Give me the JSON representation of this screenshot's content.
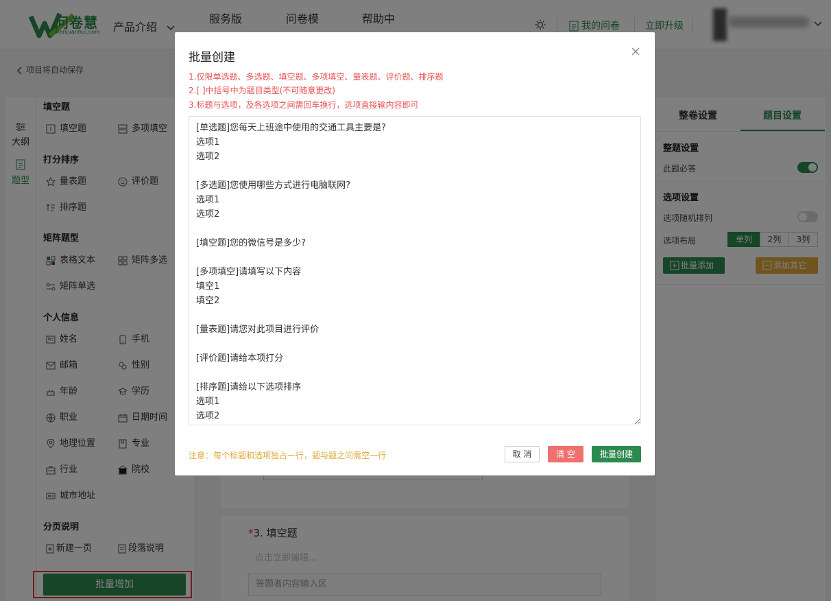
{
  "header": {
    "logo_text": "问卷慧",
    "logo_sub": "wenjuanhui.com",
    "nav": [
      "产品介绍",
      "服务版本",
      "问卷模板",
      "帮助中心"
    ],
    "my_survey": "我的问卷",
    "upgrade": "立即升级",
    "brand_color": "#2c8a4f"
  },
  "subbar": {
    "back_label": "项目将自动保存"
  },
  "iconbar": {
    "outline": "大纲",
    "types": "题型"
  },
  "left": {
    "groups": {
      "fill": "填空题",
      "score": "打分排序",
      "matrix": "矩阵题型",
      "personal": "个人信息",
      "paging": "分页说明"
    },
    "items": {
      "fill_blank": "填空题",
      "multi_fill": "多项填空",
      "scale": "量表题",
      "rating": "评价题",
      "sort": "排序题",
      "table_text": "表格文本",
      "matrix_multi": "矩阵多选",
      "matrix_single": "矩阵单选",
      "name": "姓名",
      "phone": "手机",
      "email": "邮箱",
      "gender": "性别",
      "age": "年龄",
      "education": "学历",
      "job": "职业",
      "datetime": "日期时间",
      "location": "地理位置",
      "major": "专业",
      "industry": "行业",
      "school": "院校",
      "address": "城市地址",
      "new_page": "新建一页",
      "paragraph": "段落说明"
    },
    "batch_add": "批量增加"
  },
  "canvas": {
    "q3_number": "3.",
    "q3_title": "填空题",
    "q3_hint": "点击立即编辑...",
    "q3_input": "答题者内容输入区"
  },
  "right": {
    "tab_whole": "整卷设置",
    "tab_question": "题目设置",
    "sec_question": "整题设置",
    "required": "此题必答",
    "sec_options": "选项设置",
    "random": "选项随机排列",
    "layout": "选项布局",
    "layout_opts": [
      "单列",
      "2列",
      "3列"
    ],
    "batch_add": "批量添加",
    "add_other": "添加其它"
  },
  "modal": {
    "title": "批量创建",
    "rules": [
      "1.仅限单选题、多选题、填空题、多项填空、量表题、评价题、排序题",
      "2.[ ]中括号中为题目类型(不可随意更改)",
      "3.标题与选项，及各选项之间需回车换行，选项直接输内容即可"
    ],
    "content": "[单选题]您每天上班途中使用的交通工具主要是?\n选项1\n选项2\n\n[多选题]您使用哪些方式进行电脑联网?\n选项1\n选项2\n\n[填空题]您的微信号是多少?\n\n[多项填空]请填写以下内容\n填空1\n填空2\n\n[量表题]请您对此项目进行评价\n\n[评价题]请给本项打分\n\n[排序题]请给以下选项排序\n选项1\n选项2",
    "note": "注意：每个标题和选项独占一行，题与题之间需空一行",
    "cancel": "取 消",
    "clear": "清 空",
    "create": "批量创建"
  }
}
